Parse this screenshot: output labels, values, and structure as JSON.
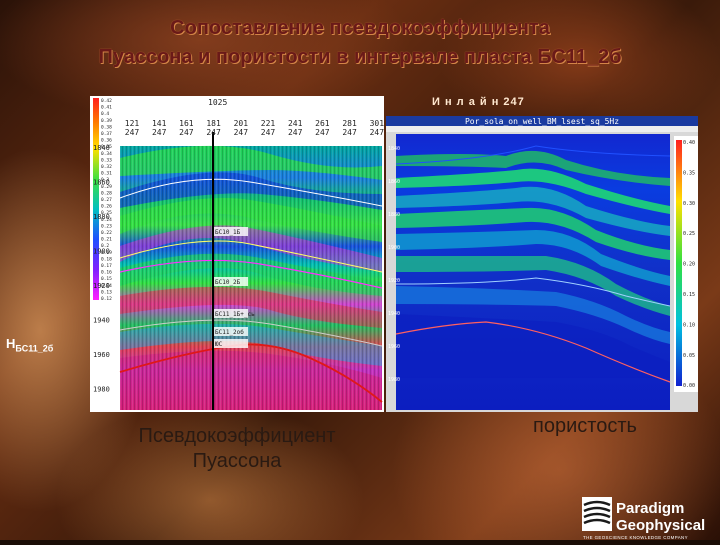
{
  "title": {
    "line1": "Сопоставление псевдокоэффициента",
    "line2": "Пуассона и пористости в интервале пласта БС11_2б"
  },
  "inline_label": "И н л а й н  247",
  "horizon_label": {
    "main": "Н",
    "sub": "БС11_2б"
  },
  "left_panel": {
    "top_marker": "1025",
    "trace_numbers": [
      "121",
      "141",
      "161",
      "181",
      "201",
      "221",
      "241",
      "261",
      "281",
      "301"
    ],
    "trace_line": [
      "247",
      "247",
      "247",
      "247",
      "247",
      "247",
      "247",
      "247",
      "247",
      "247"
    ],
    "depth_ticks": [
      "1840",
      "1860",
      "1880",
      "1900",
      "1920",
      "1940",
      "1960",
      "1980"
    ],
    "horizon_tags": [
      "БС10_1Б",
      "БС10_2Б",
      "БС11_1Б+_сь",
      "БС11_2об",
      "ЮС"
    ],
    "colorscale_values": [
      "0.42",
      "0.41",
      "0.4",
      "0.39",
      "0.38",
      "0.37",
      "0.36",
      "0.35",
      "0.34",
      "0.33",
      "0.32",
      "0.31",
      "0.3",
      "0.29",
      "0.28",
      "0.27",
      "0.26",
      "0.25",
      "0.24",
      "0.23",
      "0.22",
      "0.21",
      "0.2",
      "0.19",
      "0.18",
      "0.17",
      "0.16",
      "0.15",
      "0.14",
      "0.13",
      "0.12"
    ]
  },
  "right_panel": {
    "header_title": "Por_sola_on_well_BM_lsest_sq_5Hz",
    "depth_ticks": [
      "1840",
      "1860",
      "1880",
      "1900",
      "1920",
      "1940",
      "1960",
      "1980"
    ],
    "colorscale_values": [
      "0.40",
      "0.35",
      "0.30",
      "0.25",
      "0.20",
      "0.15",
      "0.10",
      "0.05",
      "0.00"
    ]
  },
  "labels": {
    "left_caption": "Псевдокоэффициент Пуассона",
    "right_caption": "пористость"
  },
  "logo": {
    "line1": "Paradigm",
    "line2": "Geophysical",
    "tagline": "THE GEOSCIENCE KNOWLEDGE COMPANY"
  }
}
